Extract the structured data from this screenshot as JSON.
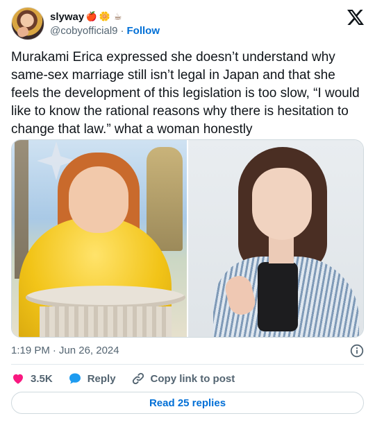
{
  "author": {
    "display_name": "slyway",
    "emojis": [
      "🍎",
      "🌼",
      "☕"
    ],
    "handle": "@cobyofficial9",
    "separator": "·",
    "follow_label": "Follow"
  },
  "tweet": {
    "text": "Murakami Erica expressed she doesn’t understand why same-sex marriage still isn’t legal in Japan and that she feels the development of this legislation is too slow, “I would like to know the rational reasons why there is hesitation to change that law.” what a woman honestly"
  },
  "media": {
    "photo_count": 2
  },
  "meta": {
    "time": "1:19 PM",
    "separator": "·",
    "date": "Jun 26, 2024"
  },
  "actions": {
    "like_count": "3.5K",
    "reply_label": "Reply",
    "copy_link_label": "Copy link to post"
  },
  "read_replies_label": "Read 25 replies",
  "icons": {
    "brand": "x-logo-icon",
    "info": "info-icon",
    "like": "heart-icon",
    "reply": "speech-bubble-icon",
    "copy": "link-icon"
  },
  "colors": {
    "accent": "#006fd6",
    "like": "#f91880",
    "reply": "#1d9bf0",
    "muted": "#536471",
    "text": "#0f1419",
    "border": "#cfd9de"
  }
}
